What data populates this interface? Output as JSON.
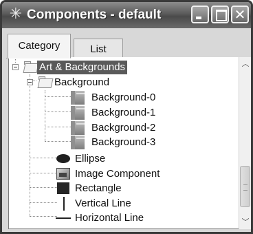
{
  "window": {
    "title": "Components - default",
    "icon": "snowflake-icon",
    "controls": [
      "minimize",
      "maximize",
      "close"
    ]
  },
  "tabs": [
    {
      "label": "Category",
      "active": true
    },
    {
      "label": "List",
      "active": false
    }
  ],
  "tree": {
    "root": {
      "label": "Art & Backgrounds",
      "expanded": true,
      "selected": true,
      "icon": "folder-icon",
      "children": [
        {
          "label": "Background",
          "expanded": true,
          "icon": "folder-icon",
          "children": [
            {
              "label": "Background-0",
              "icon": "background-icon"
            },
            {
              "label": "Background-1",
              "icon": "background-icon"
            },
            {
              "label": "Background-2",
              "icon": "background-icon"
            },
            {
              "label": "Background-3",
              "icon": "background-icon"
            }
          ]
        },
        {
          "label": "Ellipse",
          "icon": "ellipse-icon"
        },
        {
          "label": "Image Component",
          "icon": "image-icon"
        },
        {
          "label": "Rectangle",
          "icon": "rectangle-icon"
        },
        {
          "label": "Vertical Line",
          "icon": "vertical-line-icon"
        },
        {
          "label": "Horizontal Line",
          "icon": "horizontal-line-icon"
        }
      ]
    }
  }
}
